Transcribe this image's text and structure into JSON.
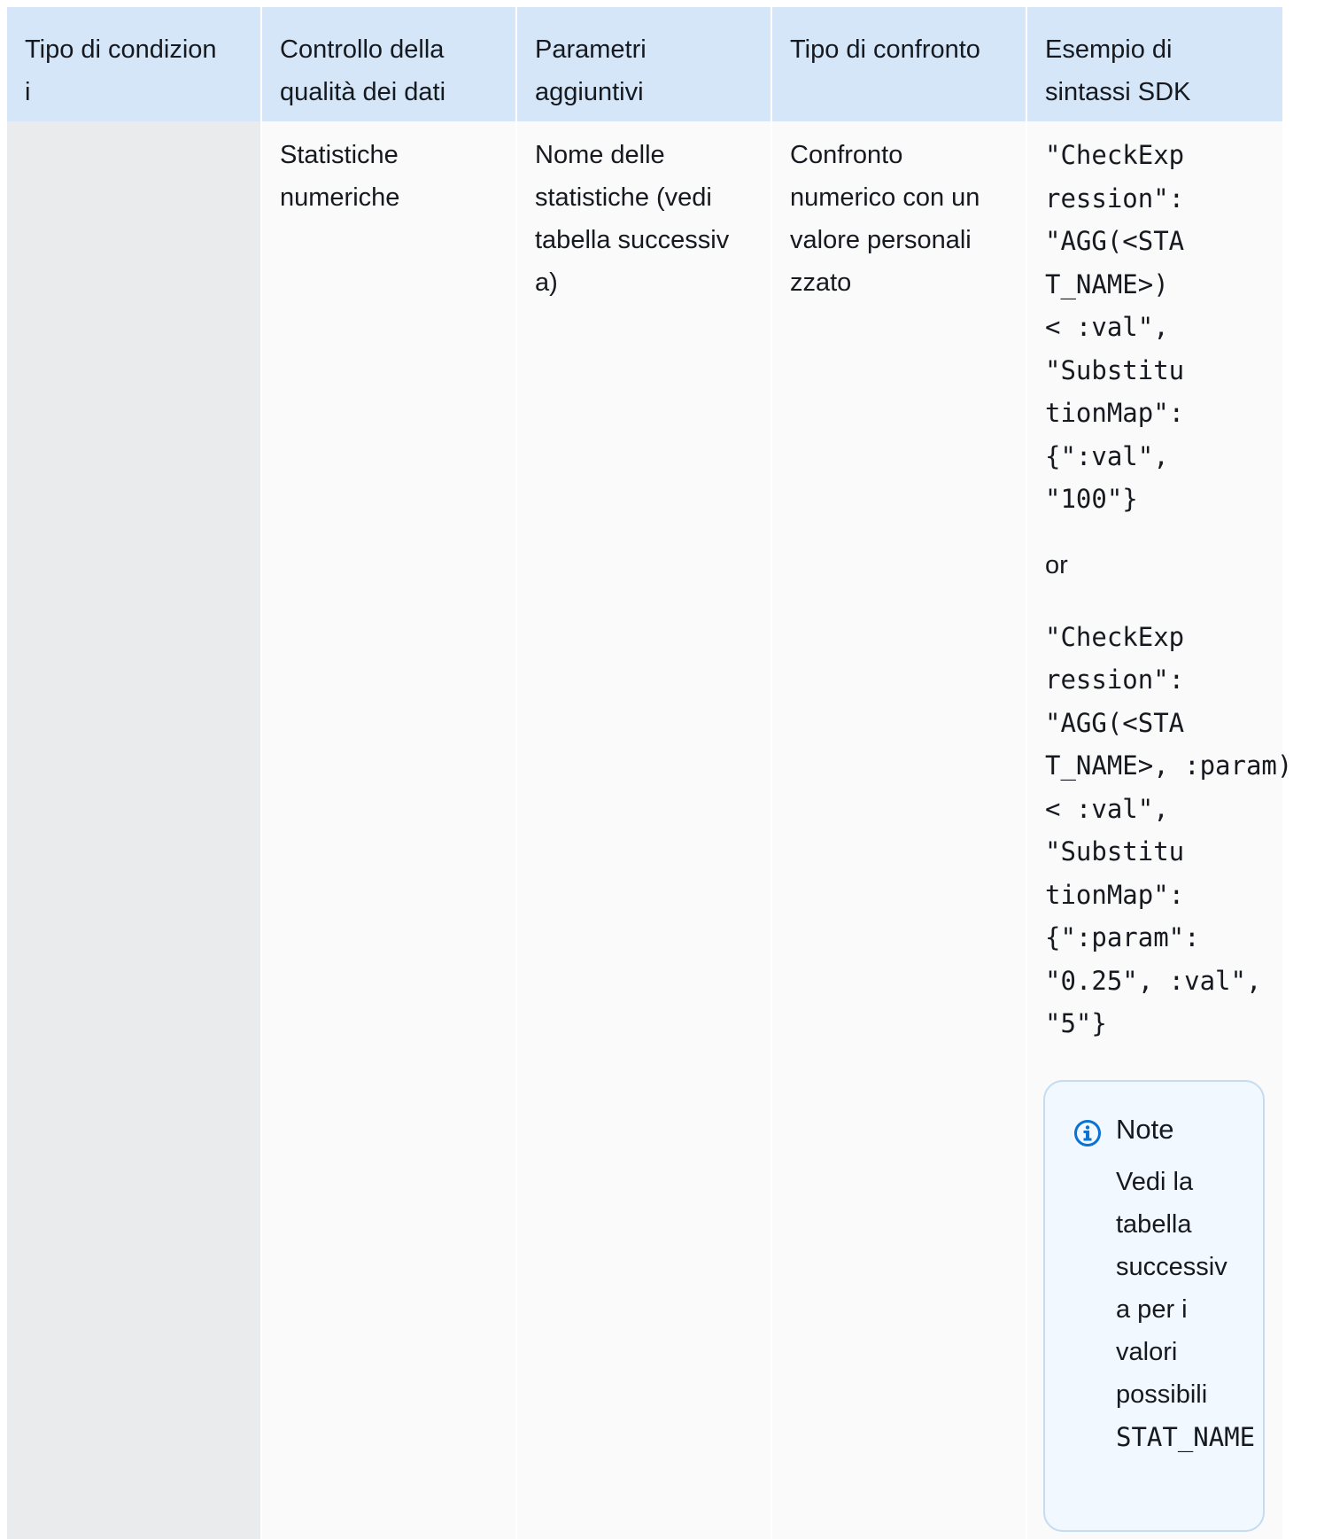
{
  "table": {
    "headers": [
      [
        "Tipo di condizion",
        "i"
      ],
      [
        "Controllo della",
        "qualità dei dati"
      ],
      [
        "Parametri",
        "aggiuntivi"
      ],
      [
        "Tipo di confronto"
      ],
      [
        "Esempio di",
        "sintassi SDK"
      ]
    ],
    "row": {
      "col1": [],
      "col2": [
        "Statistiche",
        "numeriche"
      ],
      "col3": [
        "Nome delle",
        "statistiche (vedi",
        "tabella successiv",
        "a)"
      ],
      "col4": [
        "Confronto",
        "numerico con un",
        "valore personali",
        "zzato"
      ],
      "code_block_1": [
        "\"CheckExp",
        "ression\":",
        "\"AGG(<STA",
        "T_NAME>)",
        "< :val\",",
        "\"Substitu",
        "tionMap\":",
        "{\":val\",",
        "\"100\"}"
      ],
      "or_text": "or",
      "code_block_2": [
        "\"CheckExp",
        "ression\":",
        "\"AGG(<STA",
        "T_NAME>, :param)",
        "< :val\",",
        "\"Substitu",
        "tionMap\":",
        "{\":param\":",
        "\"0.25\", :val\",",
        "\"5\"}"
      ]
    }
  },
  "note": {
    "icon": "info-icon",
    "title": "Note",
    "lines": [
      "Vedi la",
      "tabella",
      "successiv",
      "a per i",
      "valori",
      "possibili"
    ],
    "code_line": "STAT_NAME"
  },
  "colors": {
    "header_bg": "#d4e6f7",
    "first_column_bg": "#e9ebed",
    "body_bg": "#fafafa",
    "note_bg": "#f1f8ff",
    "note_border": "#c5dbf0",
    "info_icon": "#0972d3"
  }
}
